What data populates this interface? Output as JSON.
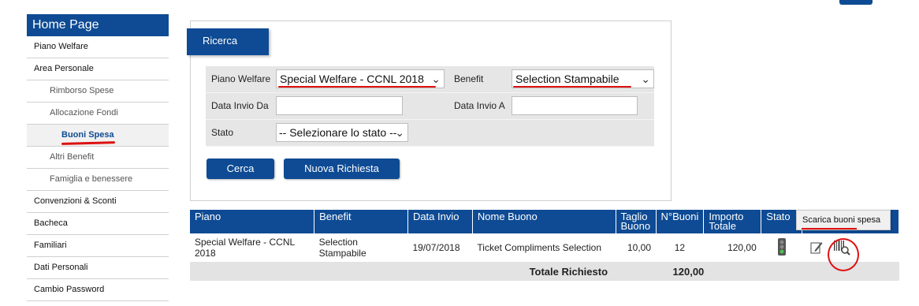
{
  "sidebar": {
    "title": "Home Page",
    "items": [
      {
        "label": "Piano Welfare"
      },
      {
        "label": "Area Personale"
      },
      {
        "label": "Rimborso Spese"
      },
      {
        "label": "Allocazione Fondi"
      },
      {
        "label": "Buoni Spesa"
      },
      {
        "label": "Altri Benefit"
      },
      {
        "label": "Famiglia e benessere"
      },
      {
        "label": "Convenzioni & Sconti"
      },
      {
        "label": "Bacheca"
      },
      {
        "label": "Familiari"
      },
      {
        "label": "Dati Personali"
      },
      {
        "label": "Cambio Password"
      }
    ]
  },
  "search": {
    "tab_label": "Ricerca",
    "piano_label": "Piano Welfare",
    "piano_value": "Special Welfare - CCNL 2018",
    "benefit_label": "Benefit",
    "benefit_value": "Selection Stampabile",
    "data_da_label": "Data Invio Da",
    "data_da_value": "",
    "data_a_label": "Data Invio A",
    "data_a_value": "",
    "stato_label": "Stato",
    "stato_value": "-- Selezionare lo stato --",
    "cerca_label": "Cerca",
    "nuova_label": "Nuova Richiesta"
  },
  "table": {
    "headers": {
      "piano": "Piano",
      "benefit": "Benefit",
      "data_invio": "Data Invio",
      "nome_buono": "Nome Buono",
      "taglio": "Taglio Buono",
      "n_buoni": "N°Buoni",
      "importo": "Importo Totale",
      "stato": "Stato"
    },
    "row": {
      "piano": "Special Welfare - CCNL 2018",
      "benefit": "Selection Stampabile",
      "data_invio": "19/07/2018",
      "nome_buono": "Ticket Compliments Selection",
      "taglio": "10,00",
      "n_buoni": "12",
      "importo": "120,00"
    },
    "footer_label": "Totale Richiesto",
    "footer_value": "120,00"
  },
  "tooltip": "Scarica buoni spesa",
  "icons": {
    "stato": "traffic-light-icon",
    "edit": "pencil-icon",
    "download": "barcode-search-icon"
  },
  "colors": {
    "primary": "#0e4b94",
    "annotation": "#dd1111"
  }
}
